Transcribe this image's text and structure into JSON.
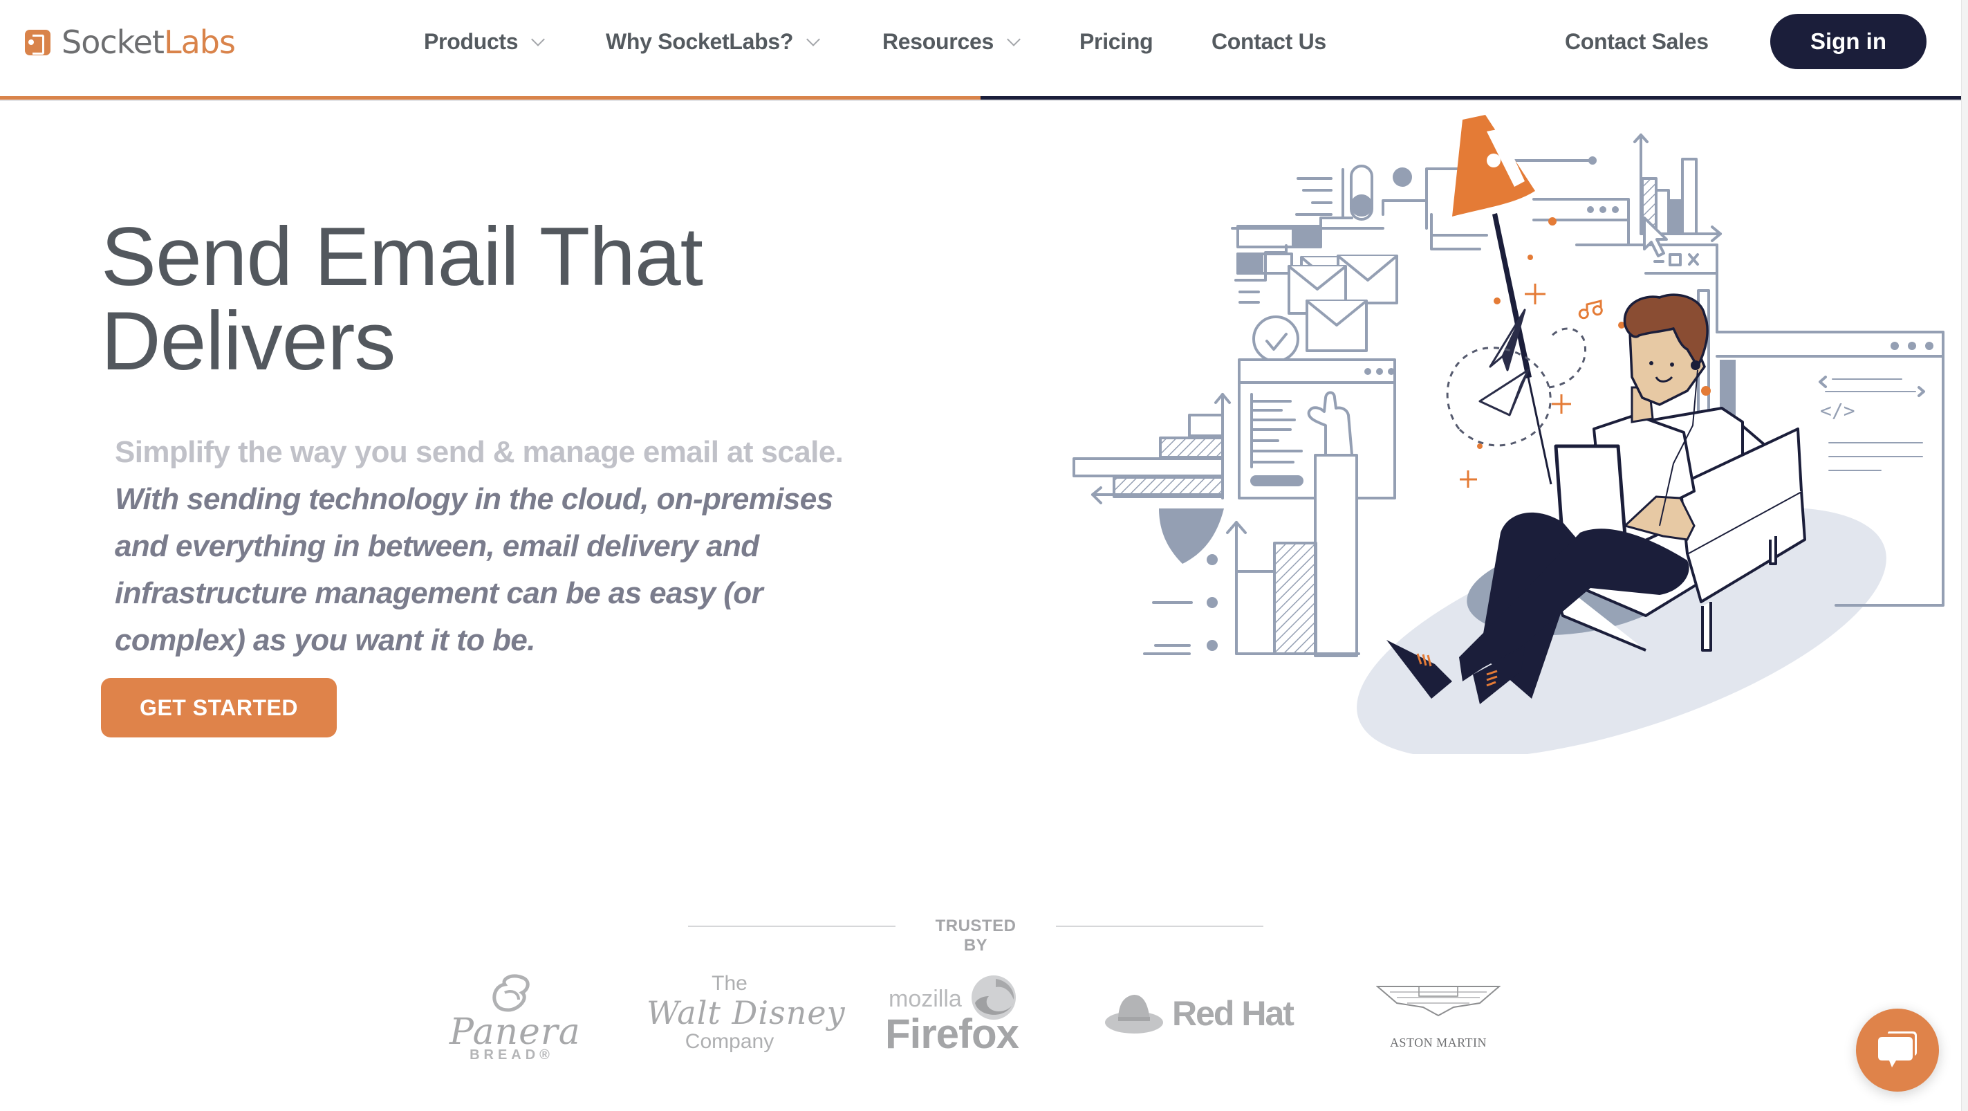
{
  "brand": {
    "name_part1": "Socket",
    "name_part2": "Labs",
    "accent_color": "#d9834a",
    "dark_color": "#1b1e3a"
  },
  "nav": {
    "items": [
      {
        "label": "Products",
        "has_dropdown": true
      },
      {
        "label": "Why SocketLabs?",
        "has_dropdown": true
      },
      {
        "label": "Resources",
        "has_dropdown": true
      },
      {
        "label": "Pricing",
        "has_dropdown": false
      },
      {
        "label": "Contact Us",
        "has_dropdown": false
      }
    ],
    "contact_sales": "Contact Sales",
    "sign_in": "Sign in"
  },
  "scroll_progress": 0.5,
  "hero": {
    "headline_line1": "Send Email That",
    "headline_line2": "Delivers",
    "lead": "Simplify the way you send & manage email at scale.",
    "body_lines": [
      "With sending technology in the cloud, on-premises",
      "and everything in between, email delivery and",
      "infrastructure management can be as easy (or",
      "complex) as you want it to be."
    ],
    "cta_label": "GET STARTED"
  },
  "illustration": {
    "description": "Person on armchair with laptop, lamp, envelopes, charts and browser windows",
    "window_controls": [
      "_",
      "□",
      "×"
    ],
    "code_snippet": "</>"
  },
  "trusted": {
    "label": "TRUSTED BY",
    "logos": [
      {
        "name": "Panera Bread",
        "line1": "Panera",
        "line2": "BREAD®"
      },
      {
        "name": "The Walt Disney Company",
        "line1": "The",
        "line2": "Walt Disney",
        "line3": "Company"
      },
      {
        "name": "Mozilla Firefox",
        "line1": "mozilla",
        "line2": "Firefox"
      },
      {
        "name": "Red Hat",
        "line1": "Red Hat"
      },
      {
        "name": "Aston Martin",
        "line1": "ASTON MARTIN"
      }
    ]
  },
  "chat": {
    "icon": "chat-bubbles-icon"
  }
}
